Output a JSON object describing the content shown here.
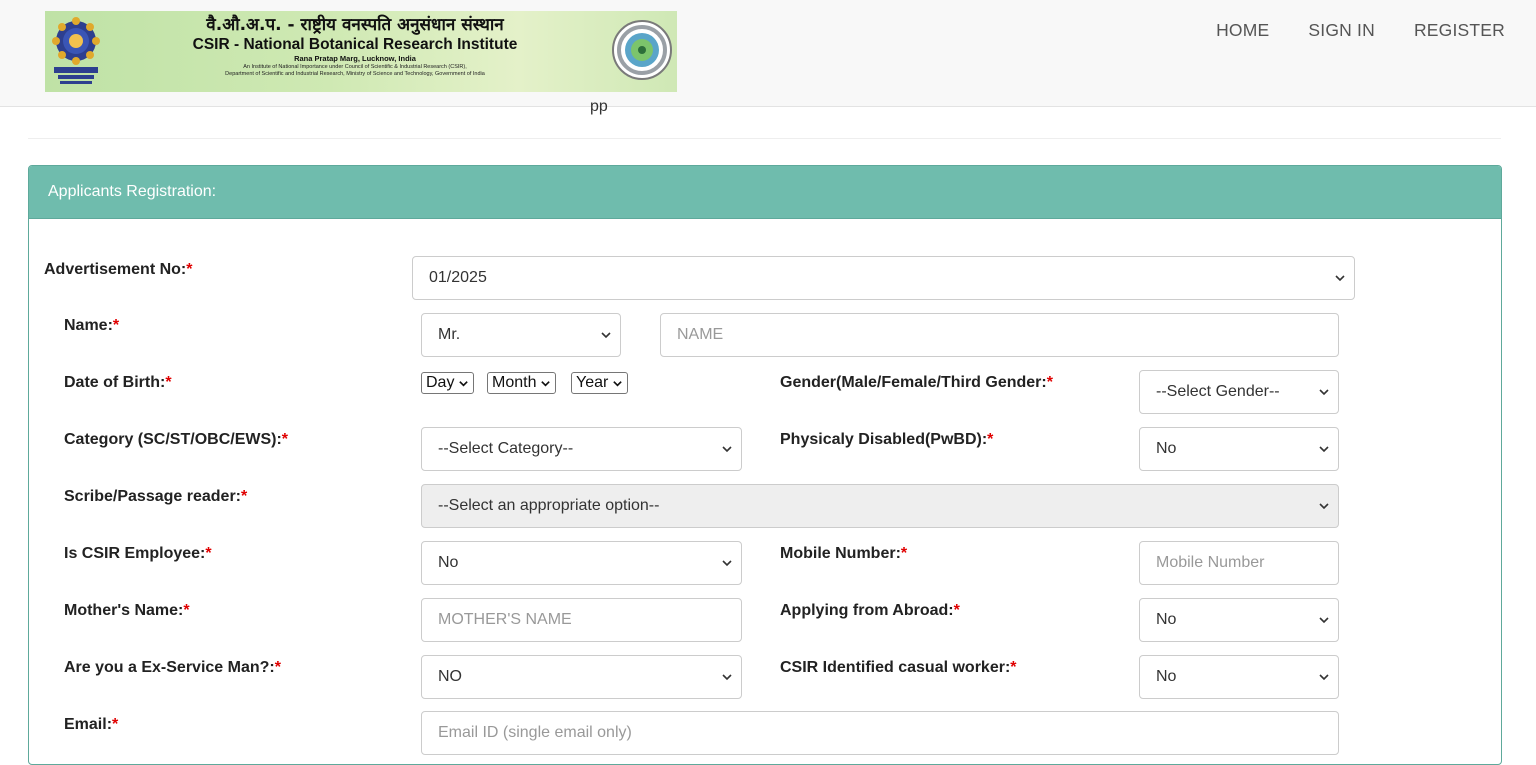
{
  "header": {
    "banner": {
      "hindi_title": "वै.औ.अ.प. - राष्ट्रीय वनस्पति अनुसंधान संस्थान",
      "title": "CSIR - National Botanical Research Institute",
      "address": "Rana Pratap Marg, Lucknow, India",
      "line1": "An Institute of National Importance under Council of Scientific & Industrial Research (CSIR),",
      "line2": "Department of Scientific and Industrial Research, Ministry of Science and Technology, Government of India"
    },
    "nav": {
      "home": "HOME",
      "sign_in": "SIGN IN",
      "register": "REGISTER"
    }
  },
  "page": {
    "ghost_text": "pp"
  },
  "panel": {
    "title": "Applicants Registration:"
  },
  "form": {
    "advertisement": {
      "label": "Advertisement No:",
      "value": "01/2025"
    },
    "name": {
      "label": "Name:",
      "title_value": "Mr.",
      "placeholder": "NAME"
    },
    "dob": {
      "label": "Date of Birth:",
      "day": "Day",
      "month": "Month",
      "year": "Year"
    },
    "gender": {
      "label": "Gender(Male/Female/Third Gender:",
      "value": "--Select Gender--"
    },
    "category": {
      "label": "Category (SC/ST/OBC/EWS):",
      "value": "--Select Category--"
    },
    "pwbd": {
      "label": "Physicaly Disabled(PwBD):",
      "value": "No"
    },
    "scribe": {
      "label": "Scribe/Passage reader:",
      "value": "--Select an appropriate option--"
    },
    "csir_employee": {
      "label": "Is CSIR Employee:",
      "value": "No"
    },
    "mobile": {
      "label": "Mobile Number:",
      "placeholder": "Mobile Number"
    },
    "mother": {
      "label": "Mother's Name:",
      "placeholder": "MOTHER'S NAME"
    },
    "abroad": {
      "label": "Applying from Abroad:",
      "value": "No"
    },
    "ex_service": {
      "label": "Are you a Ex-Service Man?:",
      "value": "NO"
    },
    "casual_worker": {
      "label": "CSIR Identified casual worker:",
      "value": "No"
    },
    "email": {
      "label": "Email:",
      "placeholder": "Email ID (single email only)"
    },
    "required_mark": "*"
  },
  "colors": {
    "panel_header": "#6fbcad",
    "panel_border": "#5ea99b",
    "required": "#e00000",
    "navbar": "#f8f8f8"
  },
  "icons": {
    "select_arrow": "chevron-down-icon",
    "logo_left": "csir-emblem-icon",
    "logo_right": "nbri-seal-icon"
  }
}
